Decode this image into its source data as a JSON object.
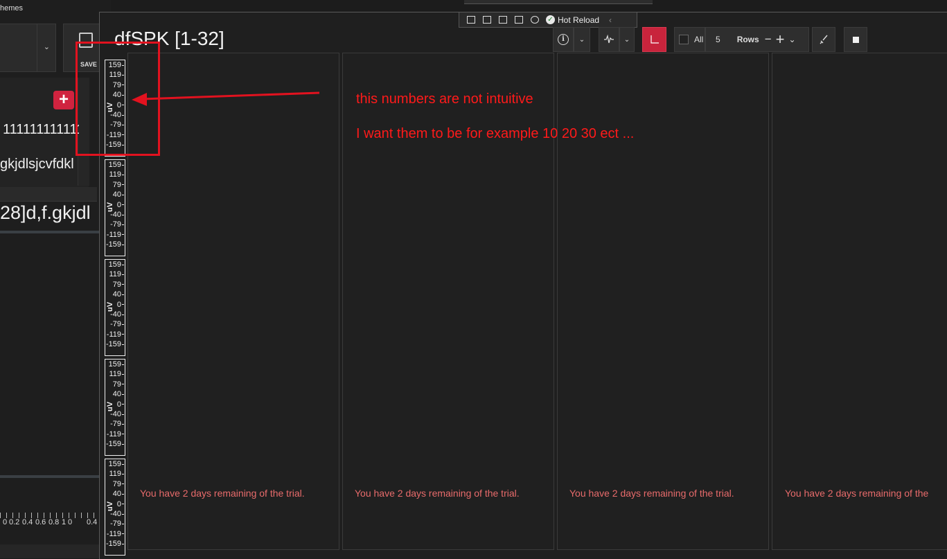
{
  "background_app": {
    "menu_label": "hemes",
    "save_label": "SAVE",
    "add_symbol": "+",
    "text_line1": "1111111111111",
    "text_line2": "gkjdlsjcvfdkl",
    "text_line3": "28]d,f.gkjdl",
    "ruler_labels": [
      "0",
      "0.2",
      "0.4",
      "0.6",
      "0.8",
      "1",
      "0",
      "0.4"
    ]
  },
  "window": {
    "title": "dfSPK [1-32]",
    "hot_reload": {
      "label": "Hot Reload"
    },
    "toolbar": {
      "all_label": "All",
      "rows_value": "5",
      "rows_label": "Rows",
      "minus_symbol": "−",
      "plus_symbol": "+"
    }
  },
  "axes": {
    "unit": "uV",
    "ticks": [
      "159",
      "119",
      "79",
      "40",
      "0",
      "-40",
      "-79",
      "-119",
      "-159"
    ],
    "count": 5
  },
  "columns": {
    "trial_message": "You have 2 days remaining of the trial.",
    "trial_message_cut": "You have 2 days remaining of the"
  },
  "annotation": {
    "line1": "this numbers are not intuitive",
    "line2": "I want them to be for example  10 20 30 ect ...",
    "color": "#ff1a1a"
  },
  "colors": {
    "accent_red": "#c8243c",
    "trial_text": "#e86b6b"
  }
}
